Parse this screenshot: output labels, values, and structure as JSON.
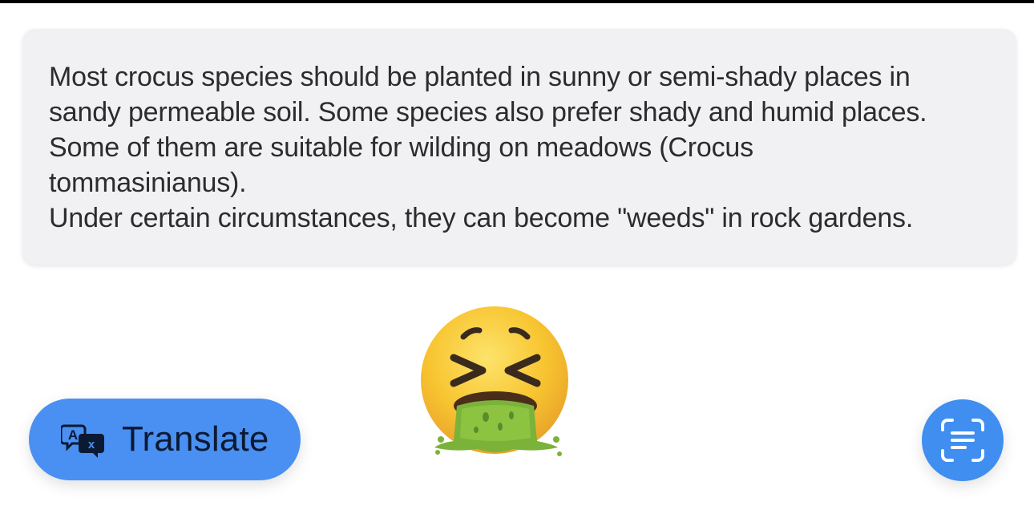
{
  "description_card": {
    "lines": [
      "Most crocus species should be planted in sunny or semi-shady places in",
      "sandy permeable soil. Some species also prefer shady and humid places.",
      "Some of them are suitable for wilding on meadows (Crocus",
      "tommasinianus).",
      "Under certain circumstances, they can become \"weeds\" in rock gardens."
    ]
  },
  "emoji": {
    "icon": "vomiting-face-emoji"
  },
  "translate_button": {
    "label": "Translate",
    "icon": "translate-icon"
  },
  "scan_button": {
    "icon": "live-text-scan-icon"
  },
  "colors": {
    "button_blue": "#4a90f2",
    "card_bg": "#f1f1f3",
    "text": "#2c2c2e"
  }
}
